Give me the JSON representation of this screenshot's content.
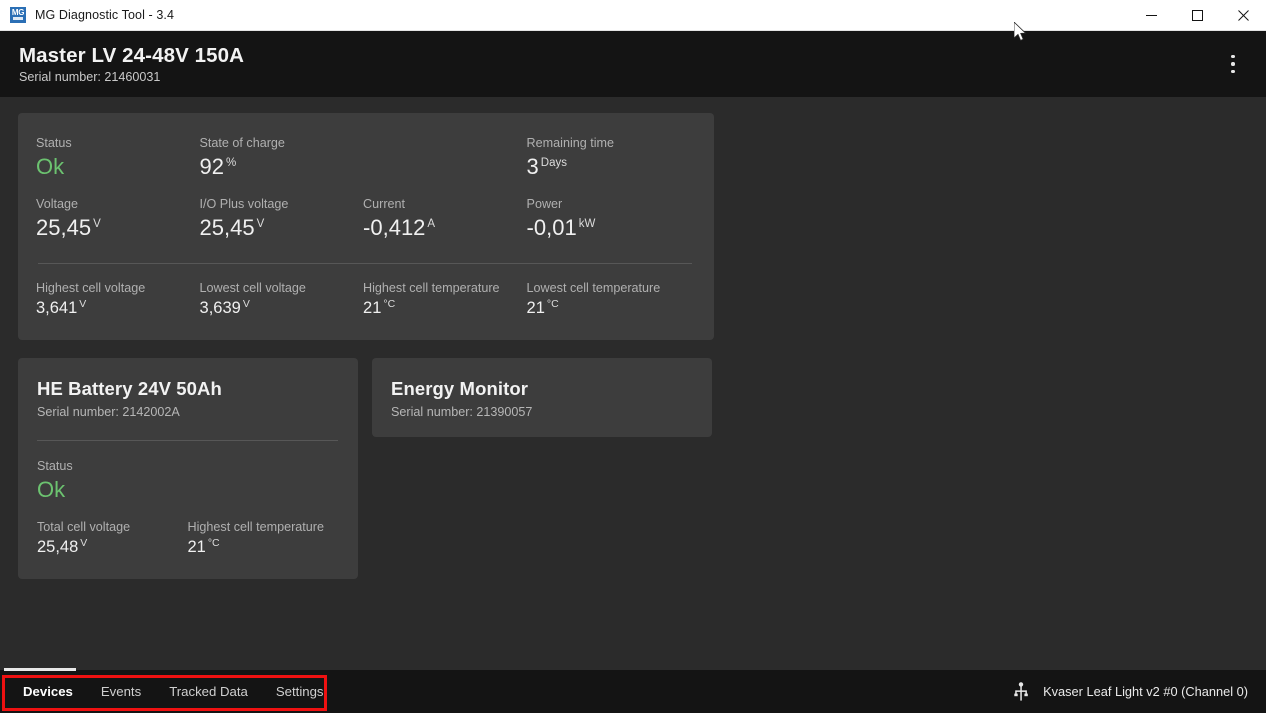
{
  "window": {
    "title": "MG Diagnostic Tool - 3.4",
    "app_icon_text": "MG",
    "icon_name": "mg-app-icon",
    "controls": {
      "minimize": "minimize-icon",
      "maximize": "maximize-icon",
      "close": "close-icon"
    }
  },
  "device_header": {
    "title": "Master LV 24-48V 150A",
    "serial": "Serial number: 21460031",
    "menu_icon": "kebab-menu-icon"
  },
  "master_card": {
    "rows": [
      [
        {
          "label": "Status",
          "value": "Ok",
          "unit": "",
          "accent": "#6cc370"
        },
        {
          "label": "State of charge",
          "value": "92",
          "unit": "%"
        },
        {
          "label": "",
          "value": "",
          "unit": ""
        },
        {
          "label": "Remaining time",
          "value": "3",
          "unit": "Days"
        }
      ],
      [
        {
          "label": "Voltage",
          "value": "25,45",
          "unit": "V"
        },
        {
          "label": "I/O Plus voltage",
          "value": "25,45",
          "unit": "V"
        },
        {
          "label": "Current",
          "value": "-0,412",
          "unit": "A"
        },
        {
          "label": "Power",
          "value": "-0,01",
          "unit": "kW"
        }
      ]
    ],
    "cell_rows": [
      {
        "label": "Highest cell voltage",
        "value": "3,641",
        "unit": "V"
      },
      {
        "label": "Lowest cell voltage",
        "value": "3,639",
        "unit": "V"
      },
      {
        "label": "Highest cell temperature",
        "value": "21",
        "unit": "°C"
      },
      {
        "label": "Lowest cell temperature",
        "value": "21",
        "unit": "°C"
      }
    ]
  },
  "sub_devices": [
    {
      "title": "HE Battery 24V 50Ah",
      "serial": "Serial number: 2142002A",
      "status_label": "Status",
      "status_value": "Ok",
      "metrics": [
        {
          "label": "Total cell voltage",
          "value": "25,48",
          "unit": "V"
        },
        {
          "label": "Highest cell temperature",
          "value": "21",
          "unit": "°C"
        }
      ]
    },
    {
      "title": "Energy Monitor",
      "serial": "Serial number: 21390057",
      "status_label": "",
      "status_value": "",
      "metrics": []
    }
  ],
  "statusbar": {
    "tabs": [
      {
        "label": "Devices",
        "active": true
      },
      {
        "label": "Events",
        "active": false
      },
      {
        "label": "Tracked Data",
        "active": false
      },
      {
        "label": "Settings",
        "active": false
      }
    ],
    "connection": {
      "icon": "usb-icon",
      "label": "Kvaser Leaf Light v2 #0 (Channel 0)"
    }
  },
  "annotation": {
    "color": "#ef1111",
    "target": "bottom-tab-bar"
  },
  "colors": {
    "status_ok": "#6cc370",
    "card_bg": "#3d3d3d",
    "content_bg": "#2b2b2b",
    "header_bg": "#141414",
    "accent_titlebar": "#2b6fb5"
  }
}
